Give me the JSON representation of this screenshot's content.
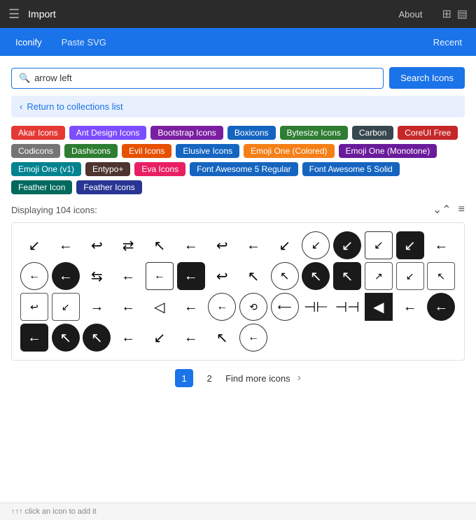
{
  "titlebar": {
    "menu_icon": "☰",
    "title": "Import",
    "nav": [
      {
        "label": "About"
      }
    ],
    "icon1": "⊞",
    "icon2": "▤"
  },
  "tabs": {
    "active": "Iconify",
    "inactive": "Paste SVG",
    "recent": "Recent"
  },
  "search": {
    "placeholder": "arrow left",
    "value": "arrow left",
    "button_label": "Search Icons"
  },
  "back": {
    "label": "Return to collections list"
  },
  "tags": [
    {
      "label": "Akar Icons",
      "color": "#e53935"
    },
    {
      "label": "Ant Design Icons",
      "color": "#7c4dff"
    },
    {
      "label": "Bootstrap Icons",
      "color": "#7b1fa2"
    },
    {
      "label": "Boxicons",
      "color": "#1565c0"
    },
    {
      "label": "Bytesize Icons",
      "color": "#2e7d32"
    },
    {
      "label": "Carbon",
      "color": "#37474f"
    },
    {
      "label": "CoreUI Free",
      "color": "#c62828"
    },
    {
      "label": "Codicons",
      "color": "#757575"
    },
    {
      "label": "Dashicons",
      "color": "#2e7d32"
    },
    {
      "label": "Evil Icons",
      "color": "#e65100"
    },
    {
      "label": "Elusive Icons",
      "color": "#1565c0"
    },
    {
      "label": "Emoji One (Colored)",
      "color": "#f57f17"
    },
    {
      "label": "Emoji One (Monotone)",
      "color": "#6a1b9a"
    },
    {
      "label": "Emoji One (v1)",
      "color": "#00838f"
    },
    {
      "label": "Entypo+",
      "color": "#4e342e"
    },
    {
      "label": "Eva Icons",
      "color": "#e91e63"
    },
    {
      "label": "Font Awesome 5 Regular",
      "color": "#1565c0"
    },
    {
      "label": "Font Awesome 5 Solid",
      "color": "#1565c0"
    },
    {
      "label": "Feather Icon",
      "color": "#00695c"
    },
    {
      "label": "Feather Icons",
      "color": "#283593"
    }
  ],
  "results": {
    "count_label": "Displaying 104 icons:"
  },
  "icons": [
    "↙",
    "←",
    "↩",
    "⇄",
    "↖",
    "←",
    "↩",
    "←",
    "↙",
    "⊙",
    "⊛",
    "↙",
    "↙",
    "←",
    "⊙",
    "⊙",
    "⇆",
    "←",
    "←",
    "←",
    "⊙",
    "↩",
    "↖",
    "⊙",
    "↖",
    "⊙",
    "⊙",
    "⊙",
    "⊙",
    "⊙",
    "⊙",
    "⊙",
    "→",
    "←",
    "◁",
    "←",
    "⊙",
    "⊙",
    "⊙",
    "⊠",
    "◀",
    "←",
    "⊙",
    "⊙",
    "⊙",
    "⊙",
    "←",
    "↙",
    "←",
    "↖",
    "⊙"
  ],
  "pagination": {
    "page1": "1",
    "page2": "2",
    "find_more": "Find more icons",
    "arrow": "›"
  },
  "status": {
    "text": "↑↑↑ click an icon to add it"
  }
}
